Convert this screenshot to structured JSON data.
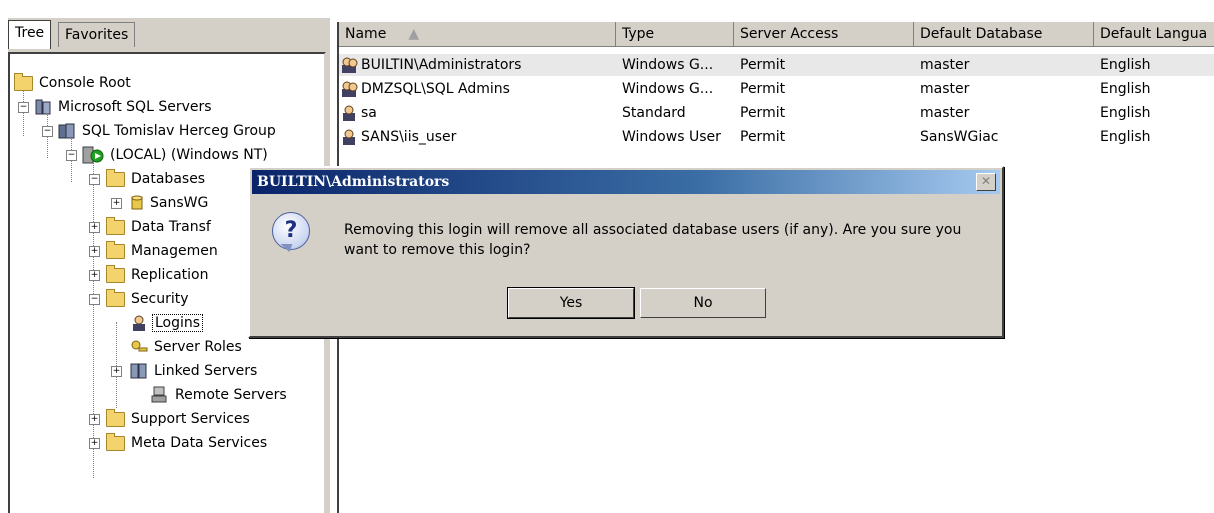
{
  "tabs": {
    "tree": "Tree",
    "favorites": "Favorites"
  },
  "tree": {
    "console_root": "Console Root",
    "sql_servers": "Microsoft SQL Servers",
    "group": "SQL Tomislav Herceg Group",
    "server": "(LOCAL) (Windows NT)",
    "databases": "Databases",
    "sanswg": "SansWG",
    "data_transf": "Data Transf",
    "management": "Managemen",
    "replication": "Replication",
    "security": "Security",
    "logins": "Logins",
    "server_roles": "Server Roles",
    "linked_servers": "Linked Servers",
    "remote_servers": "Remote Servers",
    "support_services": "Support Services",
    "meta_data_services": "Meta Data Services"
  },
  "list": {
    "headers": {
      "name": "Name",
      "type": "Type",
      "server_access": "Server Access",
      "default_database": "Default Database",
      "default_language": "Default Langua"
    },
    "rows": [
      {
        "name": "BUILTIN\\Administrators",
        "type": "Windows G...",
        "access": "Permit",
        "db": "master",
        "lang": "English"
      },
      {
        "name": "DMZSQL\\SQL Admins",
        "type": "Windows G...",
        "access": "Permit",
        "db": "master",
        "lang": "English"
      },
      {
        "name": "sa",
        "type": "Standard",
        "access": "Permit",
        "db": "master",
        "lang": "English"
      },
      {
        "name": "SANS\\iis_user",
        "type": "Windows User",
        "access": "Permit",
        "db": "SansWGiac",
        "lang": "English"
      }
    ]
  },
  "dialog": {
    "title": "BUILTIN\\Administrators",
    "message": "Removing this login will remove all associated database users (if any).  Are you sure you want to remove this login?",
    "yes": "Yes",
    "no": "No",
    "close_glyph": "✕",
    "question_glyph": "?"
  },
  "icons": {
    "folder": "folder-icon",
    "database": "database-icon",
    "server": "server-icon",
    "user": "user-icon",
    "question": "question-icon"
  },
  "colors": {
    "titlebar_start": "#0a246a",
    "titlebar_end": "#a6caf0",
    "chrome": "#d4d0c8",
    "folder": "#f3d36b"
  }
}
